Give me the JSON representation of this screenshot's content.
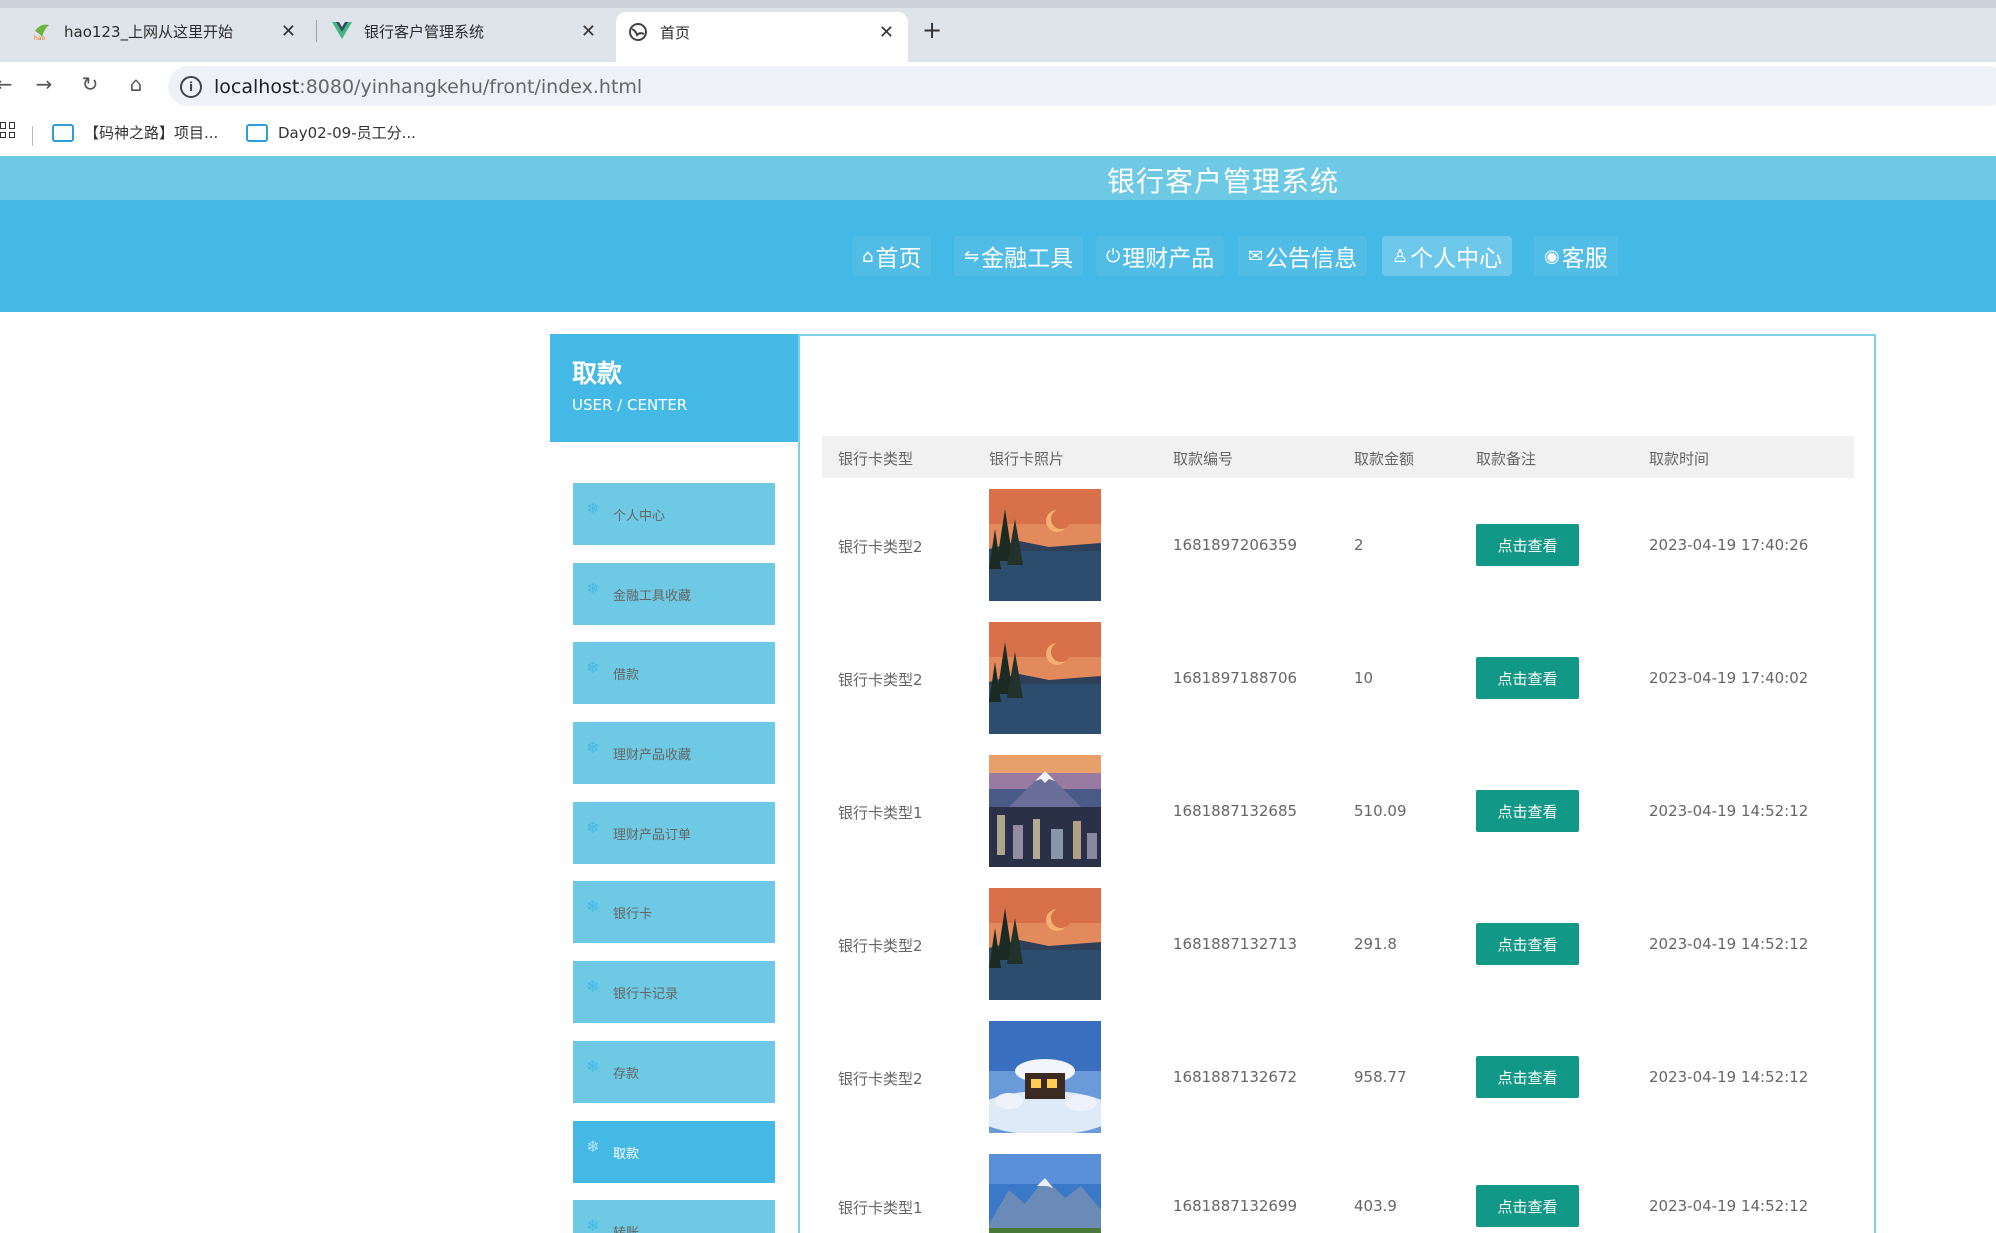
{
  "browser": {
    "tabs": [
      {
        "title": "hao123_上网从这里开始",
        "active": false
      },
      {
        "title": "银行客户管理系统",
        "active": false
      },
      {
        "title": "首页",
        "active": true
      }
    ],
    "new_tab_label": "+",
    "url_host": "localhost",
    "url_rest": ":8080/yinhangkehu/front/index.html",
    "bookmarks": [
      {
        "label": "【码神之路】项目..."
      },
      {
        "label": "Day02-09-员工分..."
      }
    ]
  },
  "site": {
    "title": "银行客户管理系统",
    "nav": [
      {
        "label": "首页",
        "icon": "home-icon",
        "glyph": "⌂",
        "active": false
      },
      {
        "label": "金融工具",
        "icon": "sliders-icon",
        "glyph": "⇋",
        "active": false
      },
      {
        "label": "理财产品",
        "icon": "power-icon",
        "glyph": "⏻",
        "active": false
      },
      {
        "label": "公告信息",
        "icon": "mail-icon",
        "glyph": "✉",
        "active": false
      },
      {
        "label": "个人中心",
        "icon": "user-icon",
        "glyph": "♙",
        "active": true
      },
      {
        "label": "客服",
        "icon": "support-icon",
        "glyph": "◉",
        "active": false
      }
    ]
  },
  "sidebar": {
    "heading": "取款",
    "subheading": "USER / CENTER",
    "items": [
      {
        "label": "个人中心",
        "active": false
      },
      {
        "label": "金融工具收藏",
        "active": false
      },
      {
        "label": "借款",
        "active": false
      },
      {
        "label": "理财产品收藏",
        "active": false
      },
      {
        "label": "理财产品订单",
        "active": false
      },
      {
        "label": "银行卡",
        "active": false
      },
      {
        "label": "银行卡记录",
        "active": false
      },
      {
        "label": "存款",
        "active": false
      },
      {
        "label": "取款",
        "active": true
      },
      {
        "label": "转账",
        "active": false
      }
    ]
  },
  "table": {
    "columns": [
      "银行卡类型",
      "银行卡照片",
      "取款编号",
      "取款金额",
      "取款备注",
      "取款时间"
    ],
    "button_label": "点击查看",
    "rows": [
      {
        "type": "银行卡类型2",
        "photo": "sunset-lake-image",
        "number": "1681897206359",
        "amount": "2",
        "time": "2023-04-19 17:40:26"
      },
      {
        "type": "银行卡类型2",
        "photo": "sunset-lake-image",
        "number": "1681897188706",
        "amount": "10",
        "time": "2023-04-19 17:40:02"
      },
      {
        "type": "银行卡类型1",
        "photo": "mountain-city-image",
        "number": "1681887132685",
        "amount": "510.09",
        "time": "2023-04-19 14:52:12"
      },
      {
        "type": "银行卡类型2",
        "photo": "sunset-lake-image",
        "number": "1681887132713",
        "amount": "291.8",
        "time": "2023-04-19 14:52:12"
      },
      {
        "type": "银行卡类型2",
        "photo": "snow-cabin-image",
        "number": "1681887132672",
        "amount": "958.77",
        "time": "2023-04-19 14:52:12"
      },
      {
        "type": "银行卡类型1",
        "photo": "alpine-meadow-image",
        "number": "1681887132699",
        "amount": "403.9",
        "time": "2023-04-19 14:52:12"
      }
    ]
  }
}
